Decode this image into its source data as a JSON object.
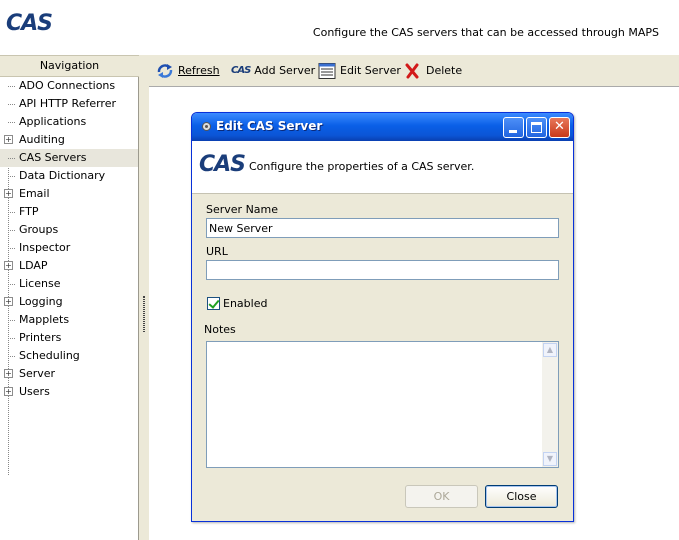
{
  "app": {
    "logo_text": "CAS",
    "header_description": "Configure the CAS servers that can be accessed through MAPS"
  },
  "navigation": {
    "title": "Navigation",
    "items": [
      {
        "label": "ADO Connections",
        "expandable": false,
        "selected": false
      },
      {
        "label": "API HTTP Referrer",
        "expandable": false,
        "selected": false
      },
      {
        "label": "Applications",
        "expandable": false,
        "selected": false
      },
      {
        "label": "Auditing",
        "expandable": true,
        "selected": false
      },
      {
        "label": "CAS Servers",
        "expandable": false,
        "selected": true
      },
      {
        "label": "Data Dictionary",
        "expandable": false,
        "selected": false
      },
      {
        "label": "Email",
        "expandable": true,
        "selected": false
      },
      {
        "label": "FTP",
        "expandable": false,
        "selected": false
      },
      {
        "label": "Groups",
        "expandable": false,
        "selected": false
      },
      {
        "label": "Inspector",
        "expandable": false,
        "selected": false
      },
      {
        "label": "LDAP",
        "expandable": true,
        "selected": false
      },
      {
        "label": "License",
        "expandable": false,
        "selected": false
      },
      {
        "label": "Logging",
        "expandable": true,
        "selected": false
      },
      {
        "label": "Mapplets",
        "expandable": false,
        "selected": false
      },
      {
        "label": "Printers",
        "expandable": false,
        "selected": false
      },
      {
        "label": "Scheduling",
        "expandable": false,
        "selected": false
      },
      {
        "label": "Server",
        "expandable": true,
        "selected": false
      },
      {
        "label": "Users",
        "expandable": true,
        "selected": false
      }
    ]
  },
  "toolbar": {
    "refresh_label": "Refresh",
    "add_label": "Add Server",
    "add_icon_text": "CAS",
    "edit_label": "Edit Server",
    "delete_label": "Delete"
  },
  "dialog": {
    "title": "Edit CAS Server",
    "logo_text": "CAS",
    "description": "Configure the properties of a CAS server.",
    "server_name_label": "Server Name",
    "server_name_value": "New Server",
    "url_label": "URL",
    "url_value": "",
    "enabled_label": "Enabled",
    "enabled_checked": true,
    "notes_label": "Notes",
    "notes_value": "",
    "ok_label": "OK",
    "close_label": "Close"
  },
  "colors": {
    "logo": "#1a3d7a",
    "panel_bg": "#ece9d8",
    "titlebar": "#0a5fe7"
  }
}
